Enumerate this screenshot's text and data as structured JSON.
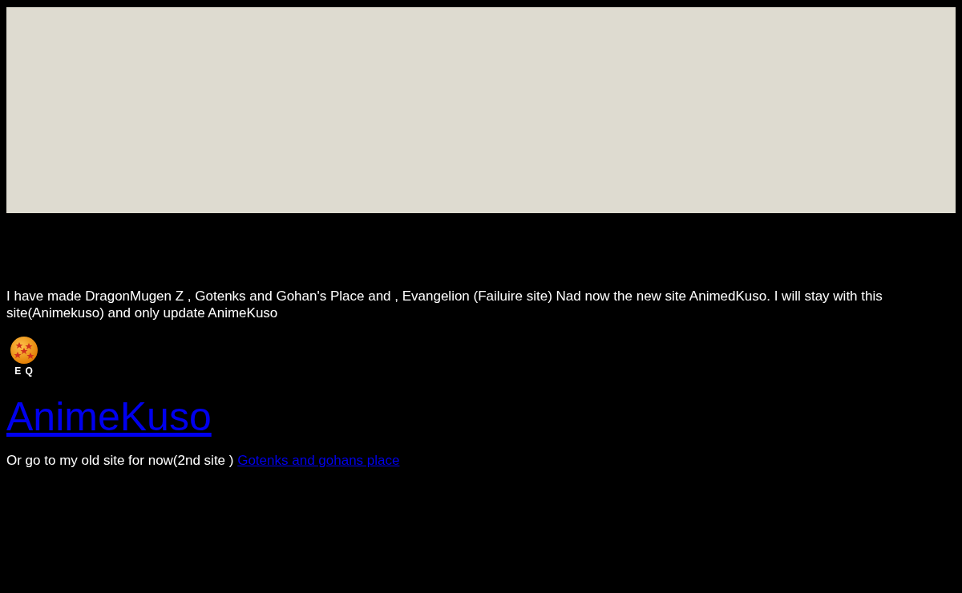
{
  "banner": {
    "kind": "panel"
  },
  "intro": "I have made DragonMugen Z , Gotenks and Gohan's Place and , Evangelion (Failuire site) Nad now the new site AnimedKuso. I will stay with this site(Animekuso) and only update AnimeKuso",
  "logo": {
    "caption": "E Q"
  },
  "main_link": "AnimeKuso",
  "old_site": {
    "text": "Or go to my old site for now(2nd site )",
    "link": "Gotenks and gohans place"
  }
}
